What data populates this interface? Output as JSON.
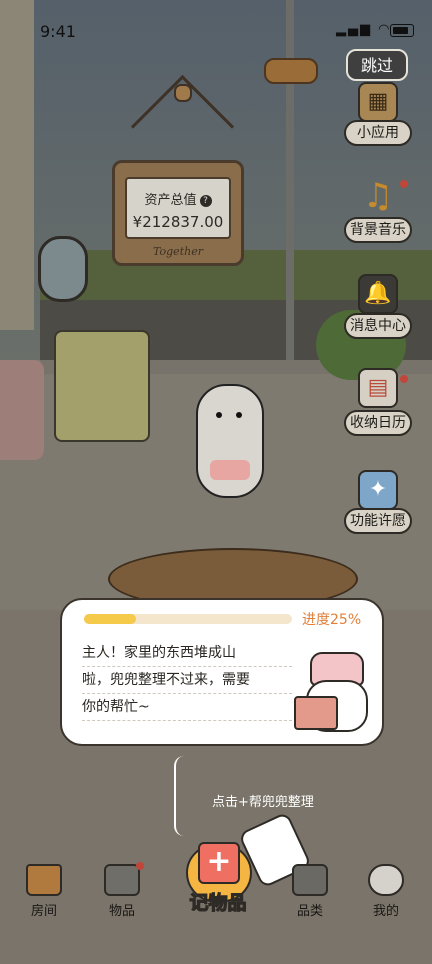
{
  "status_bar": {
    "time": "9:41",
    "signal": "▂▄▆",
    "wifi": "◠"
  },
  "header": {
    "skip_label": "跳过"
  },
  "asset_sign": {
    "label": "资产总值",
    "value": "¥212837.00",
    "signature": "Together"
  },
  "side_menu": {
    "items": [
      {
        "label": "小应用",
        "icon": "mini-app-icon",
        "badge": false
      },
      {
        "label": "背景音乐",
        "icon": "music-note-icon",
        "badge": true
      },
      {
        "label": "消息中心",
        "icon": "bell-icon",
        "badge": false
      },
      {
        "label": "收纳日历",
        "icon": "calendar-icon",
        "badge": true
      },
      {
        "label": "功能许愿",
        "icon": "wish-icon",
        "badge": false
      }
    ]
  },
  "dialog": {
    "progress_label": "进度25%",
    "progress": 0.25,
    "lines": [
      "主人！家里的东西堆成山",
      "啦，兜兜整理不过来，需要",
      "你的帮忙~"
    ]
  },
  "hint": {
    "text": "点击+帮兜兜整理"
  },
  "tabbar": {
    "tabs": [
      {
        "label": "房间",
        "icon": "house-icon"
      },
      {
        "label": "物品",
        "icon": "box-icon"
      },
      {
        "label": "品类",
        "icon": "boxes-icon"
      },
      {
        "label": "我的",
        "icon": "dog-face-icon"
      }
    ],
    "record_label": "记物品"
  },
  "colors": {
    "accent": "#f5c94a",
    "progress_text": "#e0813c",
    "badge": "#c2453a"
  }
}
